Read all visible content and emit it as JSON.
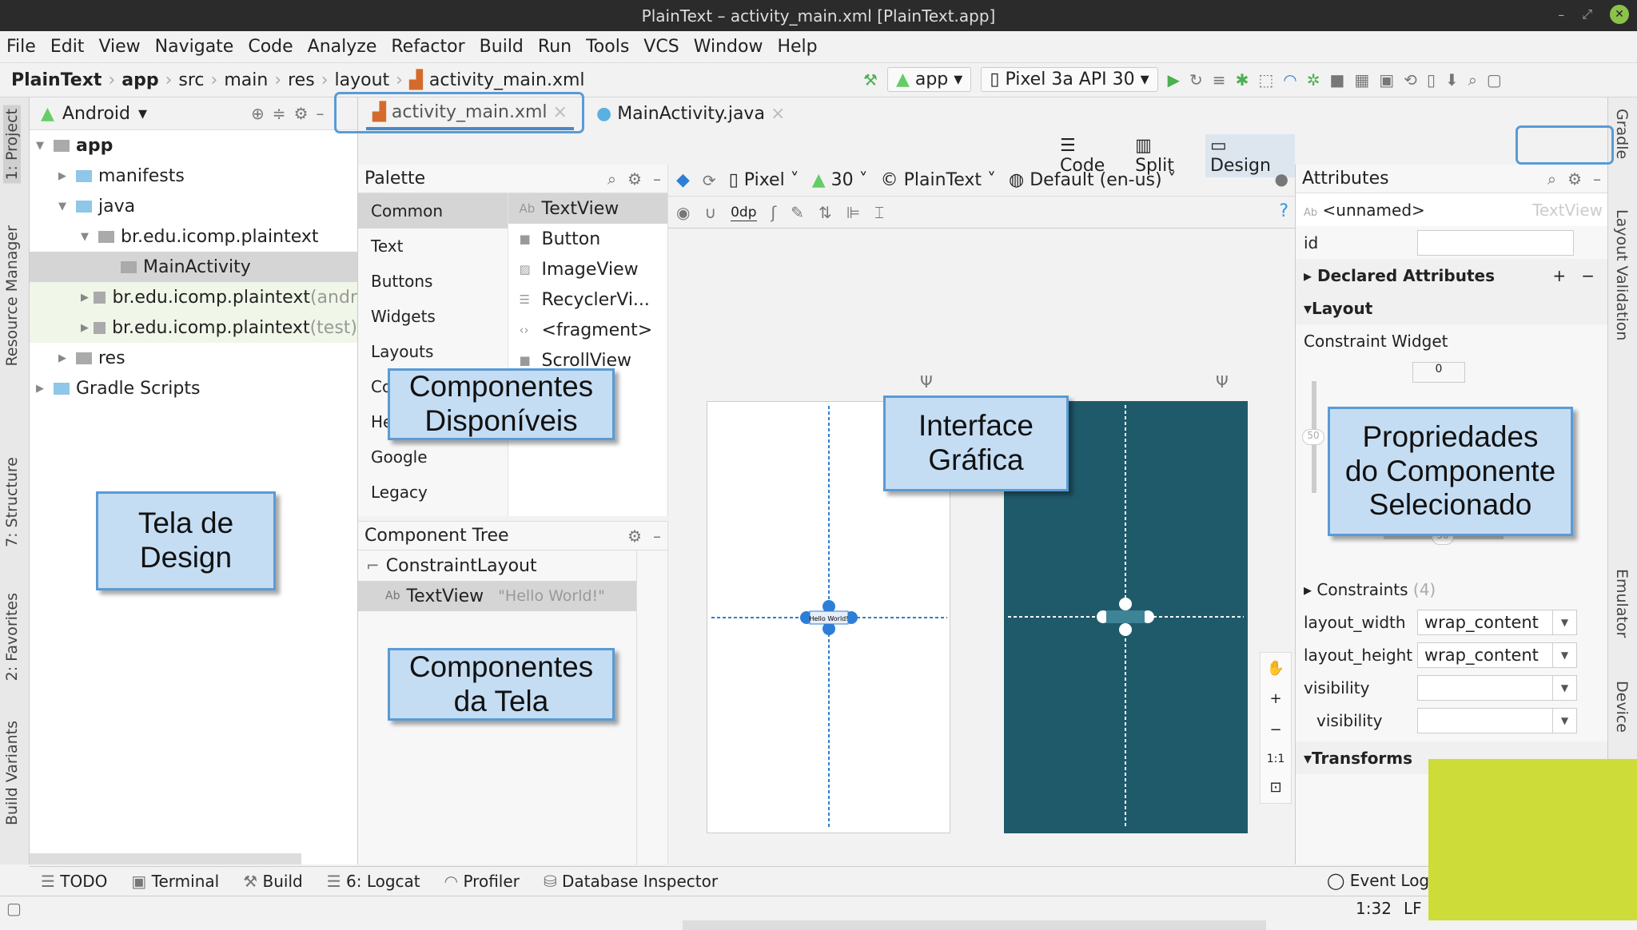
{
  "window": {
    "title": "PlainText – activity_main.xml [PlainText.app]"
  },
  "menu": [
    "File",
    "Edit",
    "View",
    "Navigate",
    "Code",
    "Analyze",
    "Refactor",
    "Build",
    "Run",
    "Tools",
    "VCS",
    "Window",
    "Help"
  ],
  "breadcrumb": [
    "PlainText",
    "app",
    "src",
    "main",
    "res",
    "layout",
    "activity_main.xml"
  ],
  "toolbar": {
    "config": "app",
    "device": "Pixel 3a API 30"
  },
  "project": {
    "view": "Android",
    "tree": [
      {
        "label": "app",
        "indent": 0,
        "arrow": "▼",
        "bold": true
      },
      {
        "label": "manifests",
        "indent": 1,
        "arrow": "▶"
      },
      {
        "label": "java",
        "indent": 1,
        "arrow": "▼"
      },
      {
        "label": "br.edu.icomp.plaintext",
        "indent": 2,
        "arrow": "▼"
      },
      {
        "label": "MainActivity",
        "indent": 3,
        "arrow": "",
        "selected": true
      },
      {
        "label": "br.edu.icomp.plaintext",
        "suffix": " (andr",
        "indent": 2,
        "arrow": "▶",
        "green": true
      },
      {
        "label": "br.edu.icomp.plaintext",
        "suffix": " (test)",
        "indent": 2,
        "arrow": "▶",
        "green": true
      },
      {
        "label": "res",
        "indent": 1,
        "arrow": "▶"
      },
      {
        "label": "Gradle Scripts",
        "indent": 0,
        "arrow": "▶"
      }
    ]
  },
  "left_strip": [
    "1: Project",
    "Resource Manager",
    "7: Structure",
    "2: Favorites",
    "Build Variants"
  ],
  "right_strip": [
    "Gradle",
    "Layout Validation",
    "Emulator",
    "Device"
  ],
  "tabs": [
    {
      "label": "activity_main.xml",
      "active": true
    },
    {
      "label": "MainActivity.java"
    }
  ],
  "modes": [
    "Code",
    "Split",
    "Design"
  ],
  "palette": {
    "title": "Palette",
    "categories": [
      "Common",
      "Text",
      "Buttons",
      "Widgets",
      "Layouts",
      "Containers",
      "Helpers",
      "Google",
      "Legacy"
    ],
    "items": [
      {
        "icon": "Ab",
        "label": "TextView"
      },
      {
        "icon": "■",
        "label": "Button"
      },
      {
        "icon": "▨",
        "label": "ImageView"
      },
      {
        "icon": "☰",
        "label": "RecyclerVi..."
      },
      {
        "icon": "‹›",
        "label": "<fragment>"
      },
      {
        "icon": "■",
        "label": "ScrollView"
      }
    ]
  },
  "design_toolbar": {
    "device": "Pixel",
    "api": "30",
    "theme": "PlainText",
    "locale": "Default (en-us)",
    "margin": "0dp"
  },
  "component_tree": {
    "title": "Component Tree",
    "items": [
      {
        "label": "ConstraintLayout"
      },
      {
        "label": "TextView",
        "value": "\"Hello World!\""
      }
    ]
  },
  "canvas": {
    "textview_text": "Hello World!",
    "zoom_fit": "1:1"
  },
  "attributes": {
    "title": "Attributes",
    "name": "<unnamed>",
    "type": "TextView",
    "id_label": "id",
    "sections": {
      "declared": "Declared Attributes",
      "layout": "Layout",
      "constraint_widget": "Constraint Widget",
      "constraints": "Constraints",
      "constraints_count": "(4)",
      "transforms": "Transforms"
    },
    "margin_top": "0",
    "bias_v": "50",
    "bias_h": "50",
    "fields": [
      {
        "label": "layout_width",
        "value": "wrap_content"
      },
      {
        "label": "layout_height",
        "value": "wrap_content"
      },
      {
        "label": "visibility",
        "value": ""
      },
      {
        "label": "visibility",
        "value": "",
        "tool": true
      }
    ]
  },
  "bottom_tabs": [
    "TODO",
    "Terminal",
    "Build",
    "6: Logcat",
    "Profiler",
    "Database Inspector"
  ],
  "event_log": "Event Log",
  "status": {
    "position": "1:32",
    "line_sep": "LF"
  },
  "callouts": {
    "design": "Tela de\nDesign",
    "palette": "Componentes\nDisponíveis",
    "canvas": "Interface\nGráfica",
    "attrs": "Propriedades\ndo Componente\nSelecionado",
    "tree": "Componentes\nda Tela"
  },
  "colors": {
    "blueprint": "#1f5a6b",
    "accent": "#2d7fd6",
    "callout": "#c5ddf3",
    "highlight": "#cddc39"
  }
}
